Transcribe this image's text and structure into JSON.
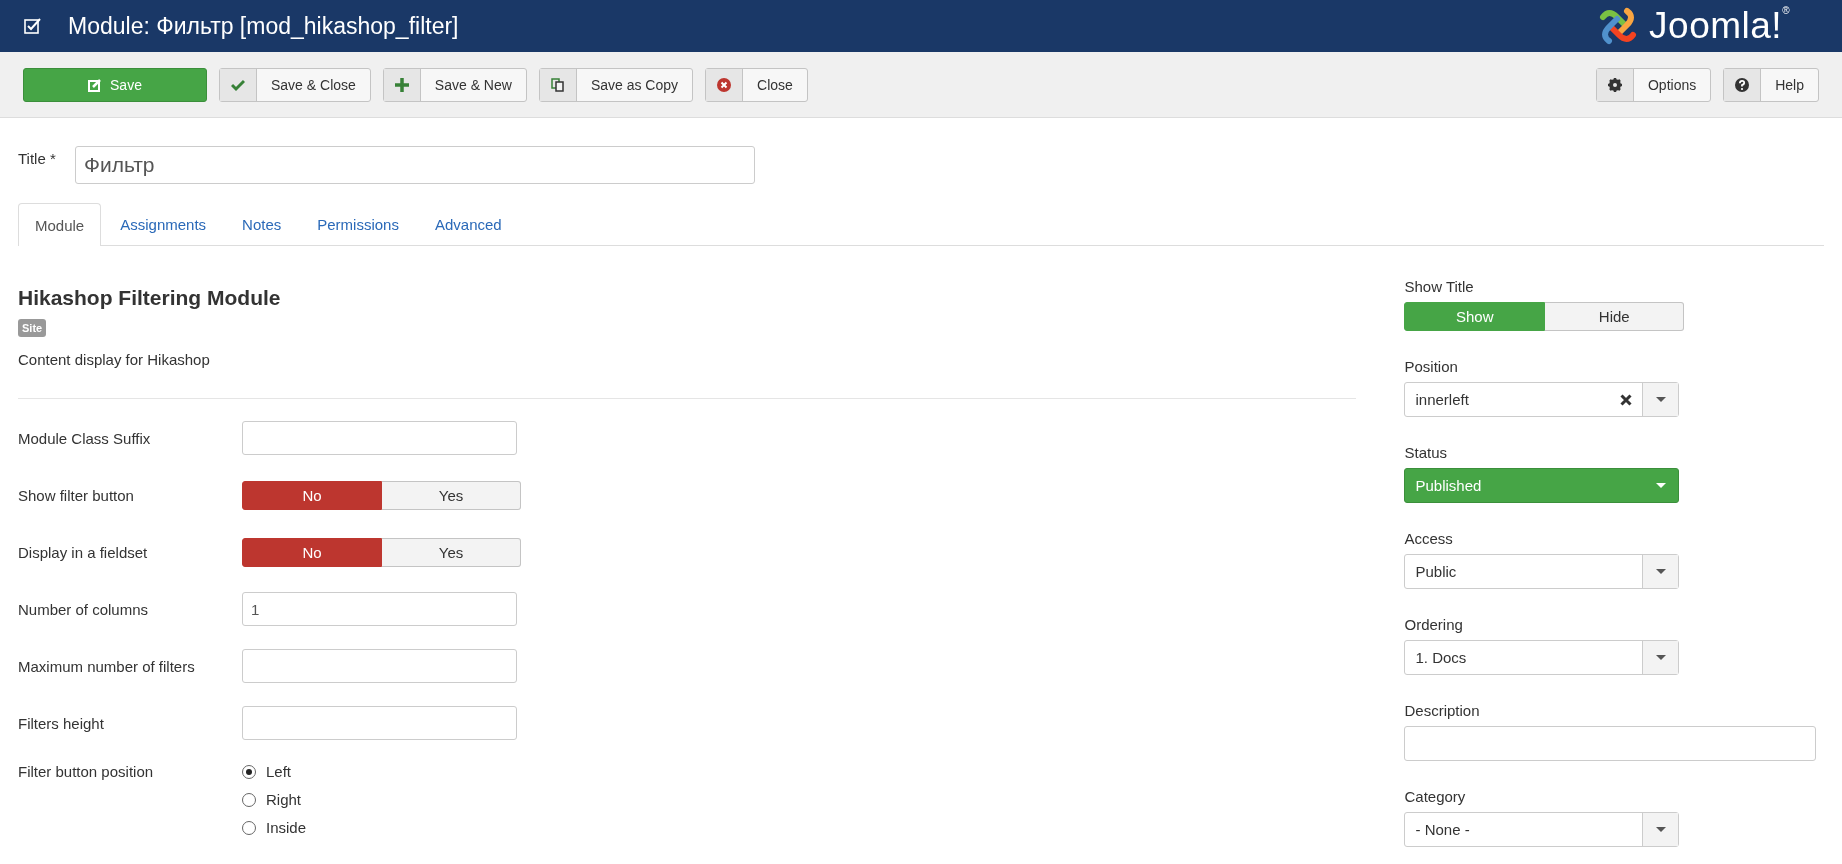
{
  "header": {
    "title": "Module: Фильтр [mod_hikashop_filter]",
    "logo_text": "Joomla!$^{®}$"
  },
  "toolbar": {
    "left": [
      {
        "label": "Save",
        "kind": "save"
      },
      {
        "label": "Save & Close",
        "kind": "check"
      },
      {
        "label": "Save & New",
        "kind": "plus"
      },
      {
        "label": "Save as Copy",
        "kind": "copy"
      },
      {
        "label": "Close",
        "kind": "close"
      }
    ],
    "right": [
      {
        "label": "Options",
        "kind": "gear"
      },
      {
        "label": "Help",
        "kind": "help"
      }
    ]
  },
  "title_field": {
    "label": "Title *",
    "value": "Фильтр"
  },
  "tabs": [
    {
      "label": "Module",
      "selected": true
    },
    {
      "label": "Assignments",
      "selected": false
    },
    {
      "label": "Notes",
      "selected": false
    },
    {
      "label": "Permissions",
      "selected": false
    },
    {
      "label": "Advanced",
      "selected": false
    }
  ],
  "module": {
    "heading": "Hikashop Filtering Module",
    "badge": "Site",
    "description": "Content display for Hikashop"
  },
  "params": [
    {
      "kind": "text",
      "label": "Module Class Suffix"
    },
    {
      "kind": "toggle",
      "label": "Show filter button",
      "options": [
        {
          "label": "No",
          "selected": true,
          "color": "#bd362f"
        },
        {
          "label": "Yes",
          "selected": false
        }
      ]
    },
    {
      "kind": "toggle",
      "label": "Display in a fieldset",
      "options": [
        {
          "label": "No",
          "selected": true,
          "color": "#bd362f"
        },
        {
          "label": "Yes",
          "selected": false
        }
      ]
    },
    {
      "kind": "text",
      "label": "Number of columns",
      "value": "1"
    },
    {
      "kind": "text",
      "label": "Maximum number of filters"
    },
    {
      "kind": "text",
      "label": "Filters height"
    },
    {
      "kind": "radio",
      "label": "Filter button position",
      "options": [
        {
          "label": "Left",
          "selected": true
        },
        {
          "label": "Right",
          "selected": false
        },
        {
          "label": "Inside",
          "selected": false
        }
      ]
    }
  ],
  "sidebar": [
    {
      "kind": "toggle",
      "label": "Show Title",
      "options": [
        {
          "label": "Show",
          "selected": true,
          "color": "#46a546"
        },
        {
          "label": "Hide",
          "selected": false
        }
      ]
    },
    {
      "kind": "select",
      "label": "Position",
      "value": "innerleft",
      "clearable": true
    },
    {
      "kind": "status",
      "label": "Status",
      "value": "Published"
    },
    {
      "kind": "select",
      "label": "Access",
      "value": "Public"
    },
    {
      "kind": "select",
      "label": "Ordering",
      "value": "1. Docs"
    },
    {
      "kind": "text",
      "label": "Description"
    },
    {
      "kind": "select",
      "label": "Category",
      "value": "- None -"
    }
  ]
}
